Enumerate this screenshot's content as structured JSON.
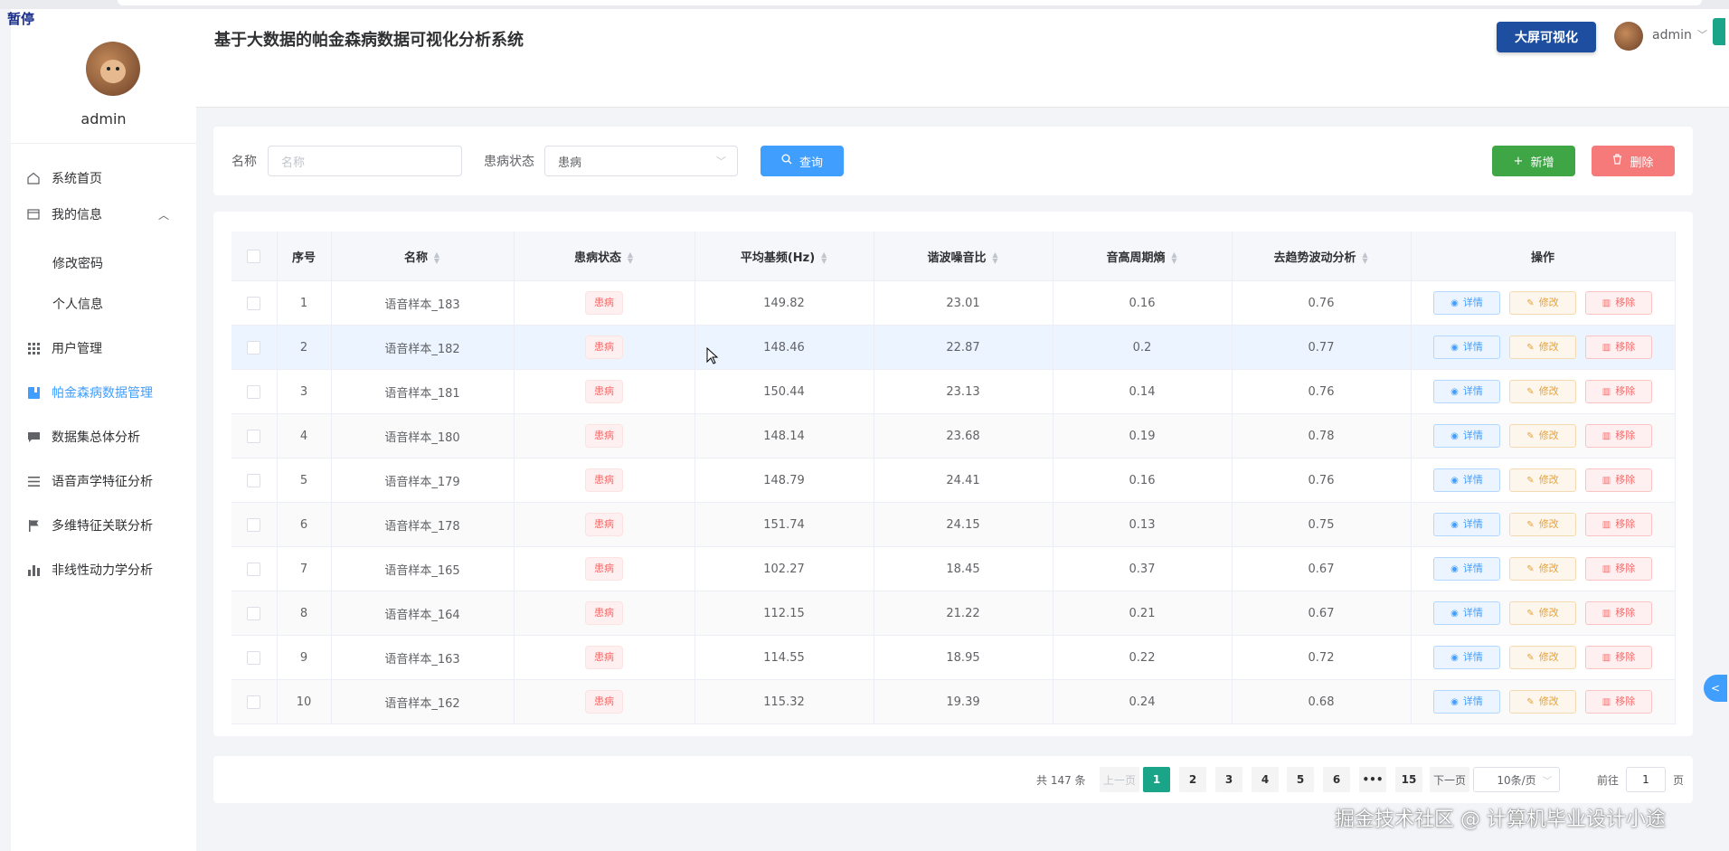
{
  "overlay": {
    "paused_label": "暂停"
  },
  "sidebar": {
    "username": "admin",
    "menu": [
      {
        "label": "系统首页",
        "icon": "home-icon"
      },
      {
        "label": "我的信息",
        "icon": "profile-icon"
      },
      {
        "label": "用户管理",
        "icon": "grid-icon"
      },
      {
        "label": "帕金森病数据管理",
        "icon": "book-icon"
      },
      {
        "label": "数据集总体分析",
        "icon": "chat-icon"
      },
      {
        "label": "语音声学特征分析",
        "icon": "list-icon"
      },
      {
        "label": "多维特征关联分析",
        "icon": "flag-icon"
      },
      {
        "label": "非线性动力学分析",
        "icon": "bar-chart-icon"
      }
    ],
    "submenu": [
      {
        "label": "修改密码"
      },
      {
        "label": "个人信息"
      }
    ]
  },
  "header": {
    "title": "基于大数据的帕金森病数据可视化分析系统",
    "big_screen_label": "大屏可视化",
    "username": "admin"
  },
  "search": {
    "name_label": "名称",
    "name_placeholder": "名称",
    "status_label": "患病状态",
    "status_value": "患病",
    "query_label": "查询",
    "add_label": "新增",
    "delete_label": "删除"
  },
  "table": {
    "columns": [
      "序号",
      "名称",
      "患病状态",
      "平均基频(Hz)",
      "谐波噪音比",
      "音高周期熵",
      "去趋势波动分析",
      "操作"
    ],
    "actions": {
      "view": "详情",
      "edit": "修改",
      "remove": "移除"
    },
    "rows": [
      {
        "idx": "1",
        "name": "语音样本_183",
        "status": "患病",
        "f0": "149.82",
        "hnr": "23.01",
        "ppe": "0.16",
        "dfa": "0.76"
      },
      {
        "idx": "2",
        "name": "语音样本_182",
        "status": "患病",
        "f0": "148.46",
        "hnr": "22.87",
        "ppe": "0.2",
        "dfa": "0.77"
      },
      {
        "idx": "3",
        "name": "语音样本_181",
        "status": "患病",
        "f0": "150.44",
        "hnr": "23.13",
        "ppe": "0.14",
        "dfa": "0.76"
      },
      {
        "idx": "4",
        "name": "语音样本_180",
        "status": "患病",
        "f0": "148.14",
        "hnr": "23.68",
        "ppe": "0.19",
        "dfa": "0.78"
      },
      {
        "idx": "5",
        "name": "语音样本_179",
        "status": "患病",
        "f0": "148.79",
        "hnr": "24.41",
        "ppe": "0.16",
        "dfa": "0.76"
      },
      {
        "idx": "6",
        "name": "语音样本_178",
        "status": "患病",
        "f0": "151.74",
        "hnr": "24.15",
        "ppe": "0.13",
        "dfa": "0.75"
      },
      {
        "idx": "7",
        "name": "语音样本_165",
        "status": "患病",
        "f0": "102.27",
        "hnr": "18.45",
        "ppe": "0.37",
        "dfa": "0.67"
      },
      {
        "idx": "8",
        "name": "语音样本_164",
        "status": "患病",
        "f0": "112.15",
        "hnr": "21.22",
        "ppe": "0.21",
        "dfa": "0.67"
      },
      {
        "idx": "9",
        "name": "语音样本_163",
        "status": "患病",
        "f0": "114.55",
        "hnr": "18.95",
        "ppe": "0.22",
        "dfa": "0.72"
      },
      {
        "idx": "10",
        "name": "语音样本_162",
        "status": "患病",
        "f0": "115.32",
        "hnr": "19.39",
        "ppe": "0.24",
        "dfa": "0.68"
      }
    ]
  },
  "pagination": {
    "total_text": "共 147 条",
    "prev_label": "上一页",
    "pages": [
      "1",
      "2",
      "3",
      "4",
      "5",
      "6",
      "•••",
      "15"
    ],
    "current_page": "1",
    "next_label": "下一页",
    "page_size": "10条/页",
    "jump_prefix": "前往",
    "jump_value": "1",
    "jump_suffix": "页"
  },
  "watermark": "掘金技术社区 @ 计算机毕业设计小途",
  "colors": {
    "primary": "#409eff",
    "success": "#3fa645",
    "danger": "#f56c6c",
    "warning": "#e6a23c",
    "pager_active": "#1aa589",
    "big_screen": "#1d4ea0"
  }
}
